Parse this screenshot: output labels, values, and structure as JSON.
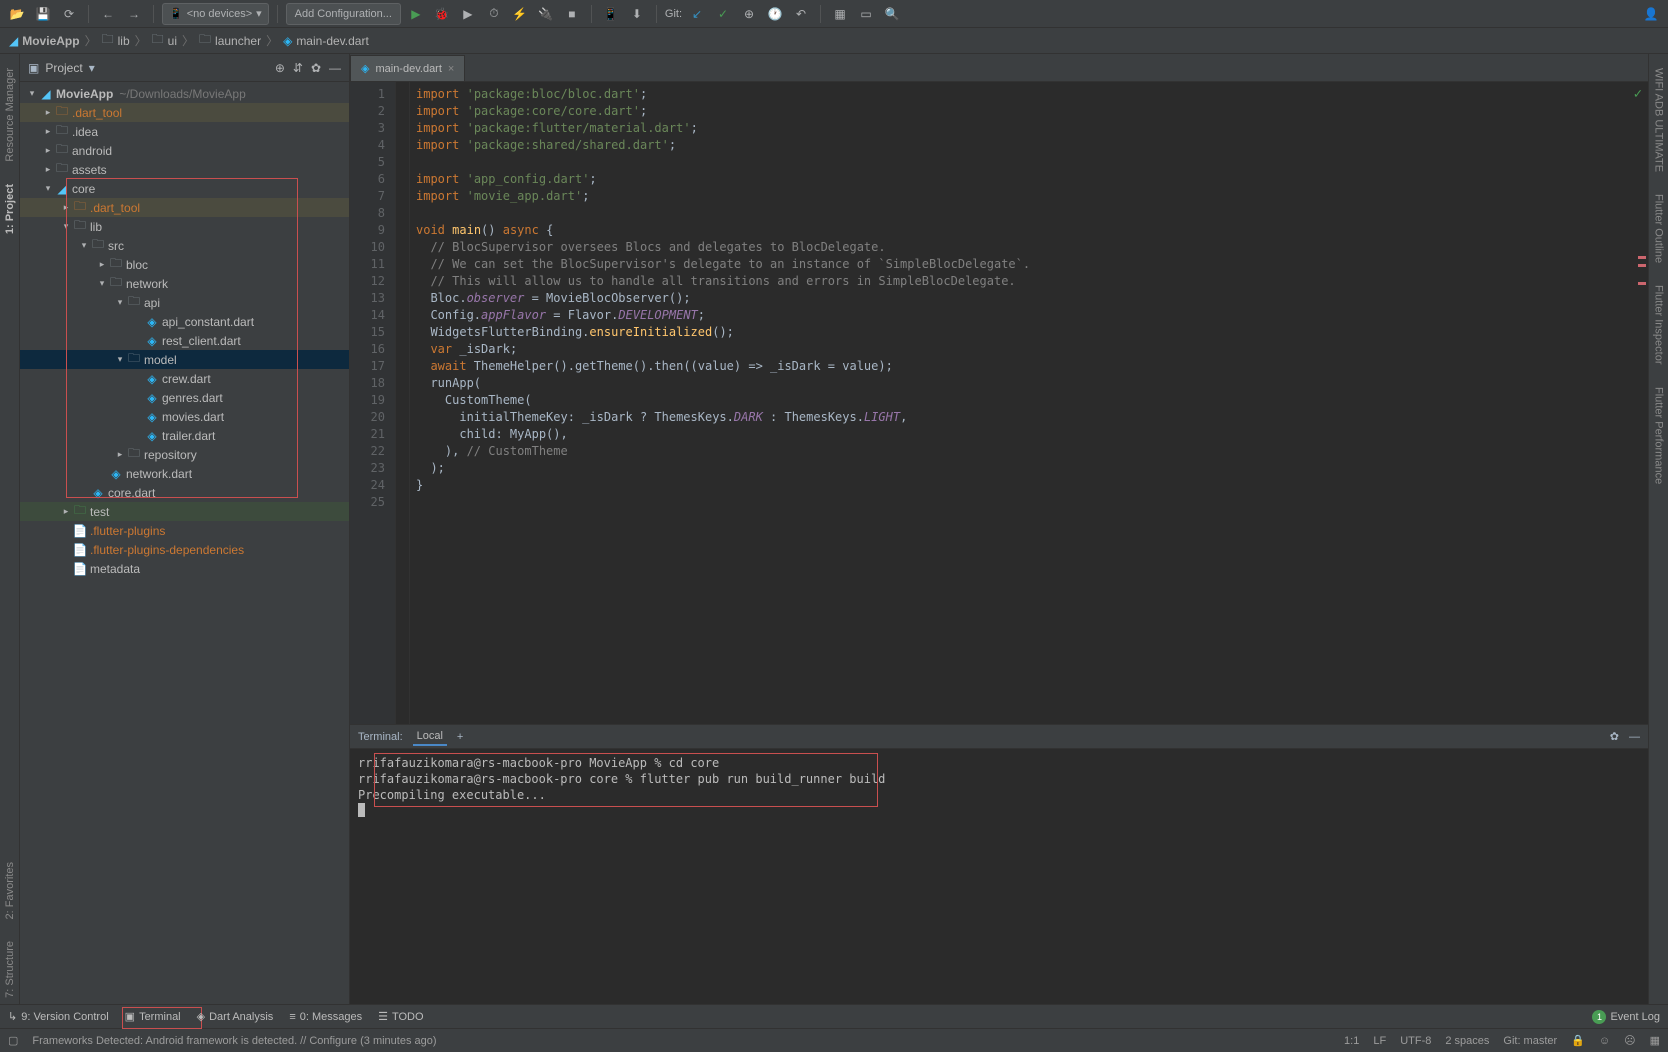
{
  "toolbar": {
    "device_label": "<no devices>",
    "config_label": "Add Configuration...",
    "git_label": "Git:"
  },
  "breadcrumb": {
    "items": [
      "MovieApp",
      "lib",
      "ui",
      "launcher",
      "main-dev.dart"
    ]
  },
  "project": {
    "panel_title": "Project",
    "root_name": "MovieApp",
    "root_path": "~/Downloads/MovieApp",
    "tree": {
      "r1": ".dart_tool",
      "r2": ".idea",
      "r3": "android",
      "r4": "assets",
      "r5": "core",
      "r6": ".dart_tool",
      "r7": "lib",
      "r8": "src",
      "r9": "bloc",
      "r10": "network",
      "r11": "api",
      "r12": "api_constant.dart",
      "r13": "rest_client.dart",
      "r14": "model",
      "r15": "crew.dart",
      "r16": "genres.dart",
      "r17": "movies.dart",
      "r18": "trailer.dart",
      "r19": "repository",
      "r20": "network.dart",
      "r21": "core.dart",
      "r22": "test",
      "r23": ".flutter-plugins",
      "r24": ".flutter-plugins-dependencies",
      "r25": "metadata"
    }
  },
  "editor": {
    "tab_name": "main-dev.dart",
    "code": {
      "l1a": "import",
      "l1b": "'package:bloc/bloc.dart'",
      "l2a": "import",
      "l2b": "'package:core/core.dart'",
      "l3a": "import",
      "l3b": "'package:flutter/material.dart'",
      "l4a": "import",
      "l4b": "'package:shared/shared.dart'",
      "l6a": "import",
      "l6b": "'app_config.dart'",
      "l7a": "import",
      "l7b": "'movie_app.dart'",
      "l9a": "void",
      "l9b": "main",
      "l9c": "async",
      "l10": "  // BlocSupervisor oversees Blocs and delegates to BlocDelegate.",
      "l11": "  // We can set the BlocSupervisor's delegate to an instance of `SimpleBlocDelegate`.",
      "l12": "  // This will allow us to handle all transitions and errors in SimpleBlocDelegate.",
      "l13a": "  Bloc.",
      "l13b": "observer",
      "l13c": " = MovieBlocObserver();",
      "l14a": "  Config.",
      "l14b": "appFlavor",
      "l14c": " = Flavor.",
      "l14d": "DEVELOPMENT",
      "l15a": "  WidgetsFlutterBinding.",
      "l15b": "ensureInitialized",
      "l16a": "var",
      "l16b": " _isDark;",
      "l17a": "await",
      "l17b": " ThemeHelper().getTheme().then((value) => _isDark = value);",
      "l18": "  runApp(",
      "l19": "    CustomTheme(",
      "l20a": "      initialThemeKey: _isDark ? ThemesKeys.",
      "l20b": "DARK",
      "l20c": " : ThemesKeys.",
      "l20d": "LIGHT",
      "l21": "      child: MyApp(),",
      "l22a": "    ), ",
      "l22b": "// CustomTheme",
      "l23": "  );",
      "l24": "}"
    }
  },
  "terminal": {
    "header_label": "Terminal:",
    "tab_label": "Local",
    "lines": {
      "l1": "rrifafauzikomara@rs-macbook-pro MovieApp % cd core",
      "l2": "rrifafauzikomara@rs-macbook-pro core % flutter pub run build_runner build",
      "l3": "Precompiling executable..."
    }
  },
  "bottom_bar": {
    "version_control": "9: Version Control",
    "terminal": "Terminal",
    "dart_analysis": "Dart Analysis",
    "messages": "0: Messages",
    "todo": "TODO",
    "event_log": "Event Log"
  },
  "status": {
    "message": "Frameworks Detected: Android framework is detected. // Configure (3 minutes ago)",
    "cursor": "1:1",
    "line_sep": "LF",
    "encoding": "UTF-8",
    "indent": "2 spaces",
    "git_branch": "Git: master"
  },
  "left_gutter": {
    "l1": "Resource Manager",
    "l2": "1: Project",
    "l3": "2: Favorites",
    "l4": "7: Structure"
  },
  "right_gutter": {
    "r1": "WIFI ADB ULTIMATE",
    "r2": "Flutter Outline",
    "r3": "Flutter Inspector",
    "r4": "Flutter Performance"
  }
}
